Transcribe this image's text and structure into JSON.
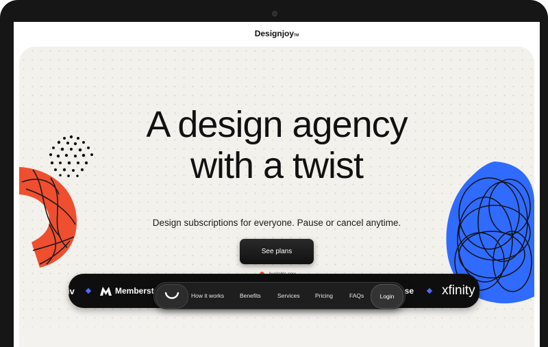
{
  "header": {
    "brand": "Designjoy",
    "brand_tm": "TM"
  },
  "hero": {
    "headline_line1": "A design agency",
    "headline_line2": "with a twist",
    "subheadline": "Design subscriptions for everyone. Pause or cancel anytime.",
    "cta_label": "See plans",
    "availability": "Available now"
  },
  "logo_strip": {
    "left_fragment": "iv",
    "memberstack": "Memberstack",
    "right_fragment": "ase",
    "xfinity": "xfinity"
  },
  "nav": {
    "items": [
      "How it works",
      "Benefits",
      "Services",
      "Pricing",
      "FAQs"
    ],
    "login": "Login"
  },
  "colors": {
    "accent_orange": "#ef4f2f",
    "accent_blue": "#2f6bff",
    "dark": "#111111",
    "background": "#f3f1ec"
  }
}
